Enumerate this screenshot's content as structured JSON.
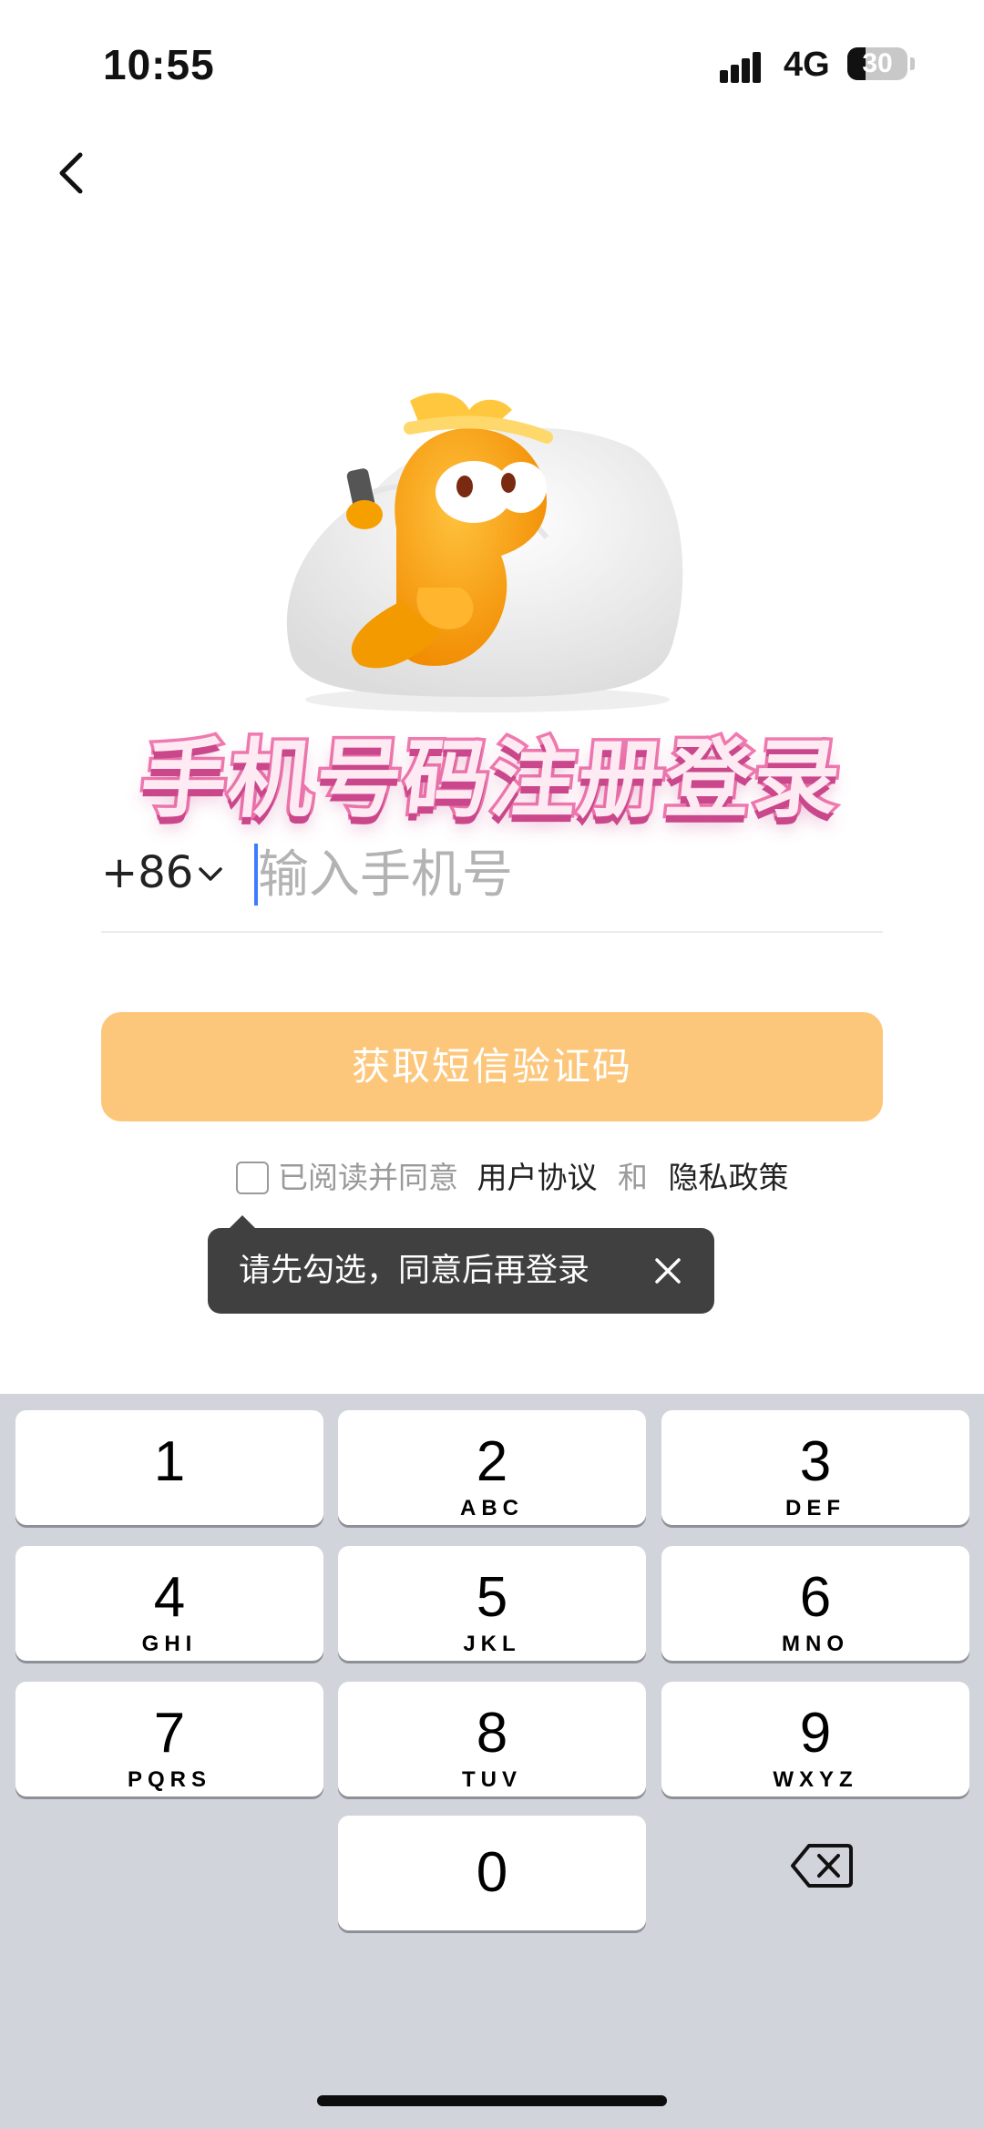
{
  "status_bar": {
    "time": "10:55",
    "network": "4G",
    "battery": "30",
    "battery_level": 0.3
  },
  "icons": {
    "back": "chevron-left-icon",
    "country_dropdown": "chevron-down-icon",
    "tooltip_close": "close-icon",
    "backspace": "backspace-icon"
  },
  "headline": "手机号码注册登录",
  "phone": {
    "country_code": "+86",
    "value": "",
    "placeholder": "输入手机号"
  },
  "sms_button": {
    "label": "获取短信验证码",
    "color": "#fdc77b"
  },
  "agreement": {
    "prefix": "已阅读并同意",
    "user_agreement": "用户协议",
    "connector": "和",
    "privacy_policy": "隐私政策",
    "checked": false
  },
  "tooltip": {
    "text": "请先勾选，同意后再登录"
  },
  "keypad": {
    "keys": [
      {
        "digit": "1",
        "letters": ""
      },
      {
        "digit": "2",
        "letters": "ABC"
      },
      {
        "digit": "3",
        "letters": "DEF"
      },
      {
        "digit": "4",
        "letters": "GHI"
      },
      {
        "digit": "5",
        "letters": "JKL"
      },
      {
        "digit": "6",
        "letters": "MNO"
      },
      {
        "digit": "7",
        "letters": "PQRS"
      },
      {
        "digit": "8",
        "letters": "TUV"
      },
      {
        "digit": "9",
        "letters": "WXYZ"
      },
      {
        "digit": "0",
        "letters": ""
      }
    ]
  }
}
